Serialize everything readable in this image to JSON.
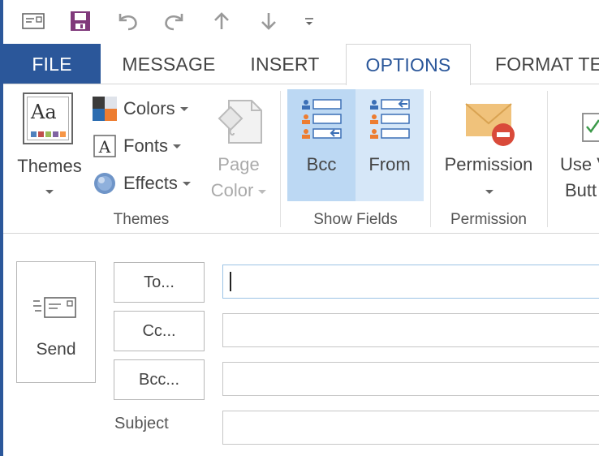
{
  "qat": {
    "icons": [
      "new-email-icon",
      "save-icon",
      "undo-icon",
      "redo-icon",
      "up-arrow-icon",
      "down-arrow-icon",
      "customize-qat-icon"
    ]
  },
  "tabs": [
    {
      "label": "FILE"
    },
    {
      "label": "MESSAGE"
    },
    {
      "label": "INSERT"
    },
    {
      "label": "OPTIONS"
    },
    {
      "label": "FORMAT TE"
    }
  ],
  "ribbon": {
    "themes_group": {
      "themes_label": "Themes",
      "colors_label": "Colors",
      "fonts_label": "Fonts",
      "effects_label": "Effects",
      "page_label": "Page",
      "color_label": "Color",
      "group_label": "Themes"
    },
    "show_fields": {
      "bcc_label": "Bcc",
      "from_label": "From",
      "group_label": "Show Fields"
    },
    "permission": {
      "button_label": "Permission",
      "group_label": "Permission"
    },
    "voting": {
      "line1": "Use V",
      "line2": "Butt"
    },
    "colors": {
      "accent": "#2b579a",
      "selected_bg": "#bcd8f3",
      "hover_bg": "#d6e7f8"
    }
  },
  "compose": {
    "send_label": "Send",
    "to_label": "To...",
    "cc_label": "Cc...",
    "bcc_label": "Bcc...",
    "subject_label": "Subject",
    "to_value": "",
    "cc_value": "",
    "bcc_value": "",
    "subject_value": ""
  }
}
